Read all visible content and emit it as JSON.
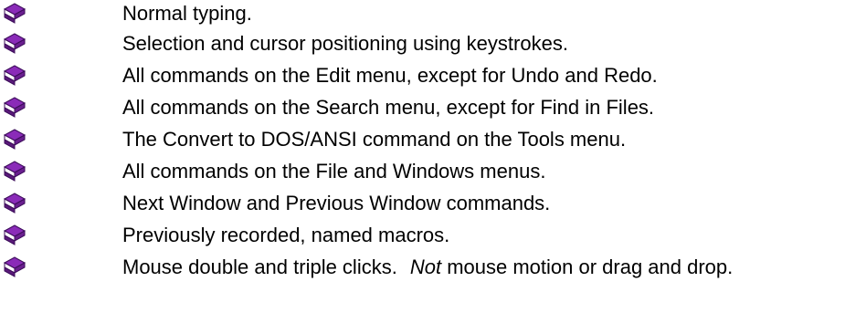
{
  "bullet_icon": "book-icon",
  "colors": {
    "book_cover": "#8a2bb8",
    "book_cover_dark": "#3c0d5a",
    "book_pages": "#ffffff",
    "text": "#000000"
  },
  "items": [
    {
      "text": "Normal typing."
    },
    {
      "text": "Selection and cursor positioning using keystrokes."
    },
    {
      "text": "All commands on the Edit menu, except for Undo and Redo."
    },
    {
      "text": "All commands on the Search menu, except for Find in Files."
    },
    {
      "text": "The Convert to DOS/ANSI command on the Tools menu."
    },
    {
      "text": "All commands on the File and Windows menus."
    },
    {
      "text": "Next Window and Previous Window commands."
    },
    {
      "text": "Previously recorded, named macros."
    },
    {
      "text": "Mouse double and triple clicks.",
      "emphasis": "Not",
      "rest": " mouse motion or drag and drop."
    }
  ]
}
